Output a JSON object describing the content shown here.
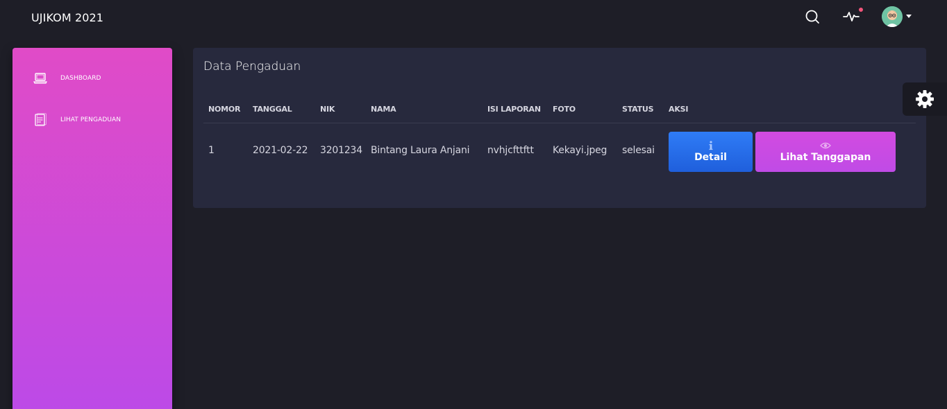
{
  "navbar": {
    "brand": "UJIKOM 2021",
    "icons": [
      "search-icon",
      "activity-icon",
      "avatar"
    ],
    "notification_color": "#f2557a"
  },
  "sidebar": {
    "gradient": [
      "#e04bc7",
      "#bb4ae8"
    ],
    "items": [
      {
        "label": "DASHBOARD",
        "icon": "laptop-icon"
      },
      {
        "label": "LIHAT PENGADUAN",
        "icon": "document-icon"
      }
    ]
  },
  "main": {
    "title": "Data Pengaduan",
    "table": {
      "columns": [
        "NOMOR",
        "TANGGAL",
        "NIK",
        "NAMA",
        "ISI LAPORAN",
        "FOTO",
        "STATUS",
        "AKSI"
      ],
      "rows": [
        [
          "1",
          "2021-02-22",
          "3201234",
          "Bintang Laura Anjani",
          "nvhjcfttftt",
          "Kekayi.jpeg",
          "selesai"
        ]
      ],
      "actions": {
        "detail_label": "Detail",
        "detail_icon": "info-icon",
        "tanggapan_label": "Lihat Tanggapan",
        "tanggapan_icon": "eye-icon"
      }
    }
  },
  "colors": {
    "background": "#1e1e27",
    "card": "#27293d",
    "detail_button": "#2f7cf6",
    "tanggapan_button": "#d24be0"
  }
}
